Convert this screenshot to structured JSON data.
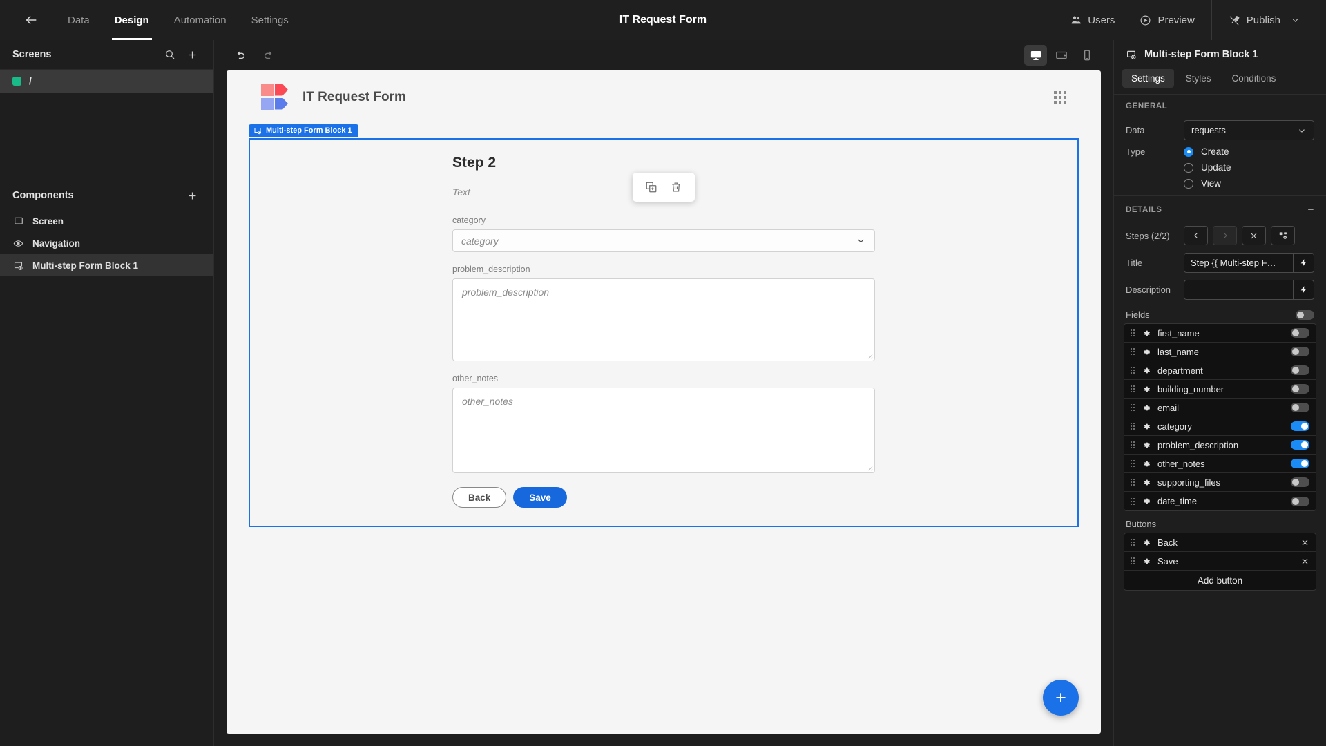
{
  "topbar": {
    "back_icon": "arrow-left-icon",
    "nav": [
      {
        "label": "Data",
        "active": false
      },
      {
        "label": "Design",
        "active": true
      },
      {
        "label": "Automation",
        "active": false
      },
      {
        "label": "Settings",
        "active": false
      }
    ],
    "title": "IT Request Form",
    "users_label": "Users",
    "preview_label": "Preview",
    "publish_label": "Publish"
  },
  "left_panel": {
    "screens_title": "Screens",
    "screens": [
      {
        "label": "/",
        "selected": true,
        "color": "#19ba88"
      }
    ],
    "components_title": "Components",
    "components": [
      {
        "label": "Screen",
        "icon": "screen-icon",
        "selected": false
      },
      {
        "label": "Navigation",
        "icon": "eye-icon",
        "selected": false
      },
      {
        "label": "Multi-step Form Block 1",
        "icon": "form-block-icon",
        "selected": true
      }
    ]
  },
  "canvas_toolbar": {
    "undo": "undo-icon",
    "redo": "redo-icon",
    "devices": [
      {
        "name": "desktop",
        "active": true
      },
      {
        "name": "tablet",
        "active": false
      },
      {
        "name": "mobile",
        "active": false
      }
    ]
  },
  "canvas": {
    "logo_colors": {
      "top_light": "#f98b8b",
      "top_dark": "#fb4a55",
      "bottom_light": "#97a6f2",
      "bottom_dark": "#5b7ceb"
    },
    "form_title": "IT Request Form",
    "float_tools": [
      {
        "name": "duplicate-icon"
      },
      {
        "name": "delete-icon"
      }
    ],
    "block_tag": "Multi-step Form Block 1",
    "step_title": "Step 2",
    "step_description": "Text",
    "fields": [
      {
        "label": "category",
        "type": "select",
        "placeholder": "category"
      },
      {
        "label": "problem_description",
        "type": "textarea",
        "placeholder": "problem_description"
      },
      {
        "label": "other_notes",
        "type": "textarea",
        "placeholder": "other_notes"
      }
    ],
    "buttons": [
      {
        "label": "Back",
        "style": "secondary"
      },
      {
        "label": "Save",
        "style": "primary"
      }
    ],
    "fab_label": "+",
    "accent_color": "#1b72e8"
  },
  "right_panel": {
    "title": "Multi-step Form Block 1",
    "tabs": [
      {
        "label": "Settings",
        "active": true
      },
      {
        "label": "Styles",
        "active": false
      },
      {
        "label": "Conditions",
        "active": false
      }
    ],
    "general": {
      "section_label": "GENERAL",
      "data_label": "Data",
      "data_value": "requests",
      "type_label": "Type",
      "type_options": [
        {
          "label": "Create",
          "selected": true
        },
        {
          "label": "Update",
          "selected": false
        },
        {
          "label": "View",
          "selected": false
        }
      ]
    },
    "details": {
      "section_label": "DETAILS",
      "steps_label": "Steps (2/2)",
      "step_buttons": [
        "prev-step-icon",
        "next-step-icon",
        "delete-step-icon",
        "add-step-icon"
      ],
      "title_label": "Title",
      "title_value": "Step {{ Multi-step F…",
      "description_label": "Description",
      "description_value": "",
      "fields_label": "Fields",
      "fields_master_on": false,
      "fields": [
        {
          "name": "first_name",
          "enabled": false
        },
        {
          "name": "last_name",
          "enabled": false
        },
        {
          "name": "department",
          "enabled": false
        },
        {
          "name": "building_number",
          "enabled": false
        },
        {
          "name": "email",
          "enabled": false
        },
        {
          "name": "category",
          "enabled": true
        },
        {
          "name": "problem_description",
          "enabled": true
        },
        {
          "name": "other_notes",
          "enabled": true
        },
        {
          "name": "supporting_files",
          "enabled": false
        },
        {
          "name": "date_time",
          "enabled": false
        }
      ],
      "buttons_label": "Buttons",
      "buttons": [
        {
          "name": "Back"
        },
        {
          "name": "Save"
        }
      ],
      "add_button_label": "Add button"
    }
  }
}
